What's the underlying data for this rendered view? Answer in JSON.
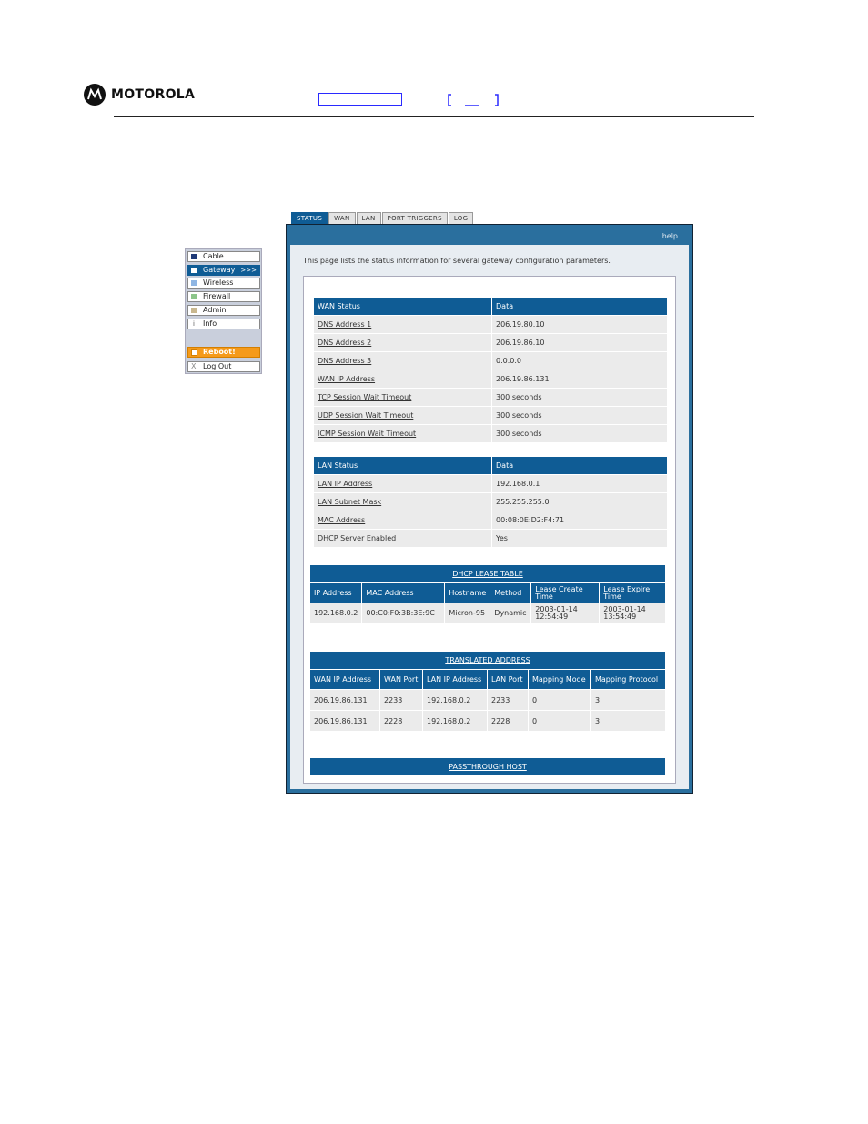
{
  "header": {
    "brand": "MOTOROLA"
  },
  "sidemenu": {
    "items": [
      {
        "label": "Cable",
        "color": "#1f3a77"
      },
      {
        "label": "Gateway",
        "color": "#ffffff",
        "arrows": ">>>"
      },
      {
        "label": "Wireless",
        "color": "#8fb6e3"
      },
      {
        "label": "Firewall",
        "color": "#8cc58a"
      },
      {
        "label": "Admin",
        "color": "#c9b88f"
      },
      {
        "label": "Info",
        "icon": "i"
      },
      {
        "label": "Reboot!"
      },
      {
        "label": "Log Out",
        "icon": "X"
      }
    ]
  },
  "tabs": [
    "STATUS",
    "WAN",
    "LAN",
    "PORT TRIGGERS",
    "LOG"
  ],
  "help": "help",
  "intro": "This page lists the status information for several gateway configuration parameters.",
  "wan": {
    "headers": [
      "WAN Status",
      "Data"
    ],
    "rows": [
      [
        "DNS Address 1",
        "206.19.80.10"
      ],
      [
        "DNS Address 2",
        "206.19.86.10"
      ],
      [
        "DNS Address 3",
        "0.0.0.0"
      ],
      [
        "WAN IP Address",
        "206.19.86.131"
      ],
      [
        "TCP Session Wait Timeout",
        "300 seconds"
      ],
      [
        "UDP Session Wait Timeout",
        "300 seconds"
      ],
      [
        "ICMP Session Wait Timeout",
        "300 seconds"
      ]
    ]
  },
  "lan": {
    "headers": [
      "LAN Status",
      "Data"
    ],
    "rows": [
      [
        "LAN IP Address",
        "192.168.0.1"
      ],
      [
        "LAN Subnet Mask",
        "255.255.255.0"
      ],
      [
        "MAC Address",
        "00:08:0E:D2:F4:71"
      ],
      [
        "DHCP Server Enabled",
        "Yes"
      ]
    ]
  },
  "dhcp": {
    "title": "DHCP LEASE TABLE",
    "headers": [
      "IP Address",
      "MAC Address",
      "Hostname",
      "Method",
      "Lease Create Time",
      "Lease Expire Time"
    ],
    "rows": [
      [
        "192.168.0.2",
        "00:C0:F0:3B:3E:9C",
        "Micron-95",
        "Dynamic",
        "2003-01-14 12:54:49",
        "2003-01-14 13:54:49"
      ]
    ]
  },
  "translated": {
    "title": "TRANSLATED ADDRESS",
    "headers": [
      "WAN IP Address",
      "WAN Port",
      "LAN IP Address",
      "LAN Port",
      "Mapping Mode",
      "Mapping Protocol"
    ],
    "rows": [
      [
        "206.19.86.131",
        "2233",
        "192.168.0.2",
        "2233",
        "0",
        "3"
      ],
      [
        "206.19.86.131",
        "2228",
        "192.168.0.2",
        "2228",
        "0",
        "3"
      ]
    ]
  },
  "passthrough": {
    "title": "PASSTHROUGH HOST"
  }
}
